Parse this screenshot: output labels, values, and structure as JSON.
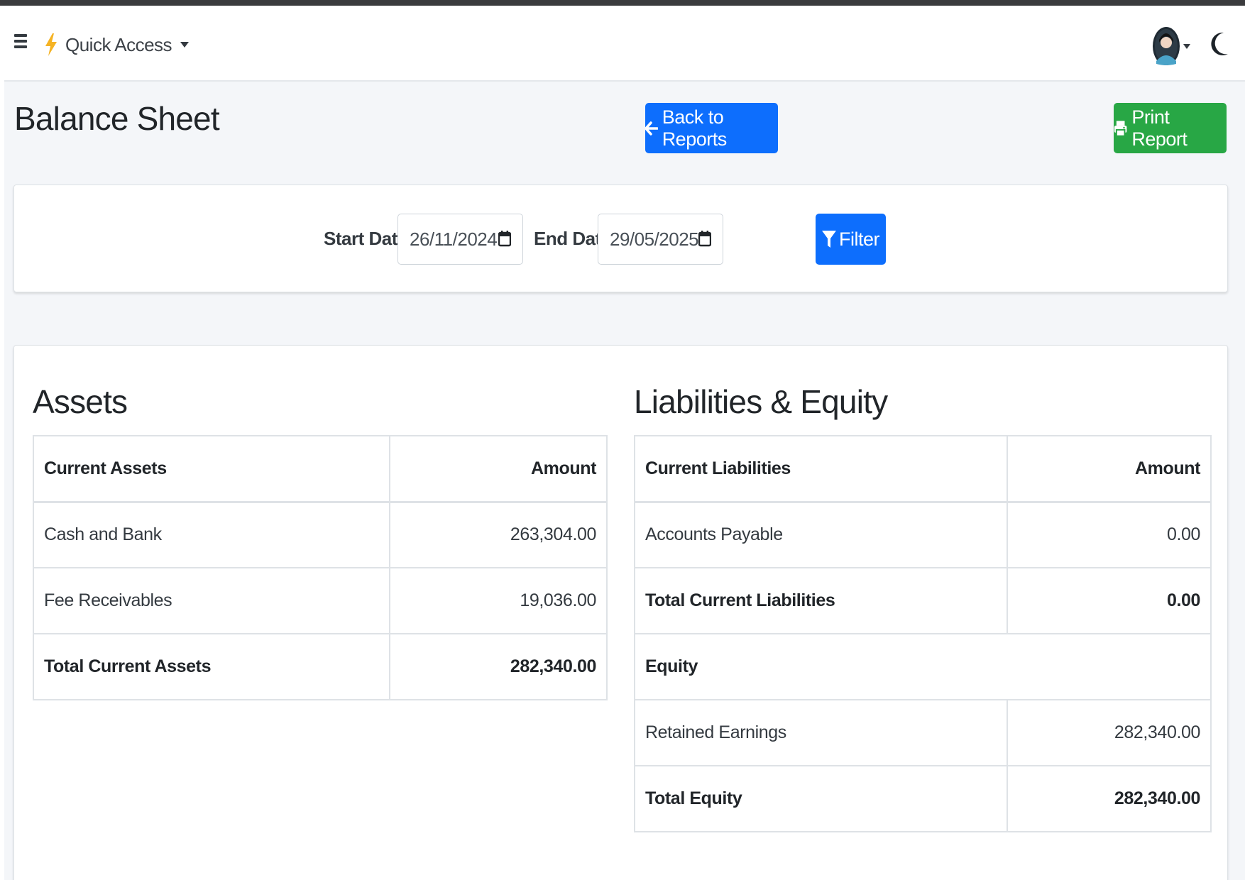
{
  "navbar": {
    "quick_access_label": "Quick Access"
  },
  "header": {
    "title": "Balance Sheet",
    "back_label": "Back to Reports",
    "print_label": "Print Report"
  },
  "filter": {
    "start_label": "Start Date:",
    "start_value": "26/11/2024",
    "end_label": "End Date:",
    "end_value": "29/05/2025",
    "filter_label": "Filter"
  },
  "assets": {
    "title": "Assets",
    "col_name": "Current Assets",
    "col_amount": "Amount",
    "rows": [
      {
        "name": "Cash and Bank",
        "amount": "263,304.00"
      },
      {
        "name": "Fee Receivables",
        "amount": "19,036.00"
      }
    ],
    "total_label": "Total Current Assets",
    "total_amount": "282,340.00"
  },
  "liabilities": {
    "title": "Liabilities & Equity",
    "col_name": "Current Liabilities",
    "col_amount": "Amount",
    "rows": [
      {
        "name": "Accounts Payable",
        "amount": "0.00"
      }
    ],
    "total_label": "Total Current Liabilities",
    "total_amount": "0.00",
    "equity_label": "Equity",
    "equity_rows": [
      {
        "name": "Retained Earnings",
        "amount": "282,340.00"
      }
    ],
    "equity_total_label": "Total Equity",
    "equity_total_amount": "282,340.00"
  },
  "colors": {
    "primary": "#0d6efd",
    "success": "#28a745",
    "background": "#f4f6f9"
  },
  "icons": [
    "hamburger-icon",
    "bolt-icon",
    "caret-down-icon",
    "avatar-icon",
    "moon-icon",
    "arrow-left-icon",
    "printer-icon",
    "calendar-icon",
    "filter-icon"
  ]
}
